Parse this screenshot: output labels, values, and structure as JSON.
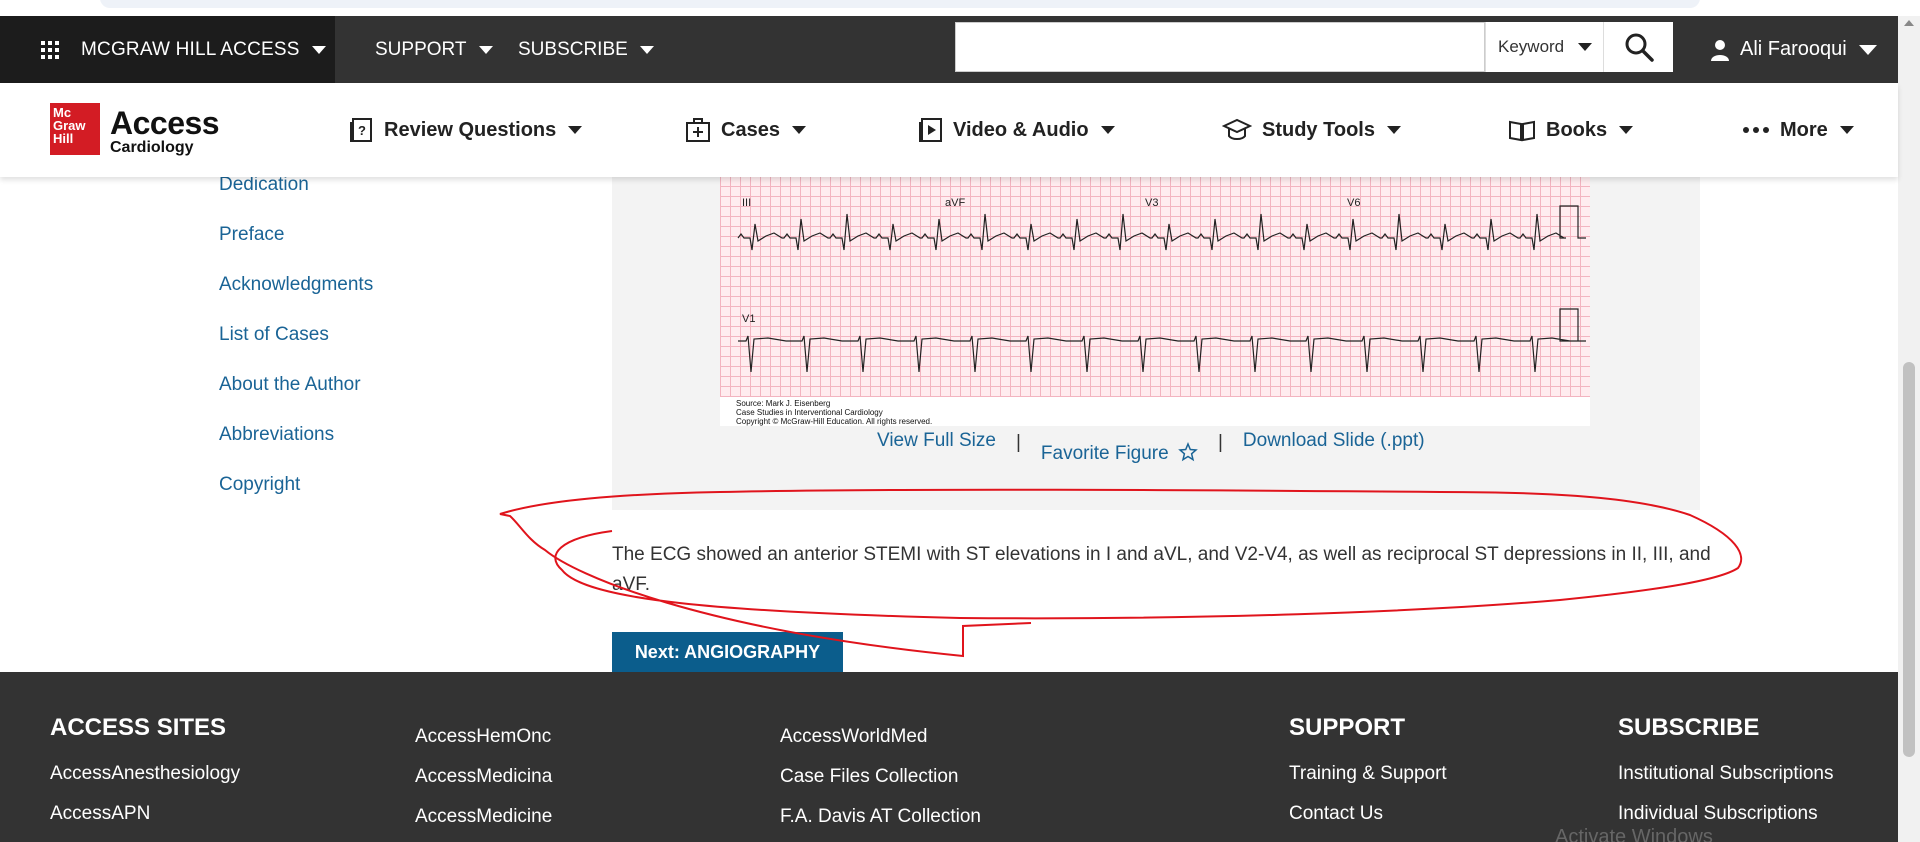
{
  "topbar": {
    "brand": "MCGRAW HILL ACCESS",
    "nav": [
      "SUPPORT",
      "SUBSCRIBE"
    ],
    "search_placeholder": "",
    "search_scope": "Keyword",
    "user_name": "Ali Farooqui"
  },
  "header": {
    "logo_mcgraw": "Mc Graw Hill",
    "logo_access": "Access",
    "logo_sub": "Cardiology",
    "nav": [
      {
        "label": "Review Questions",
        "icon": "question-book-icon"
      },
      {
        "label": "Cases",
        "icon": "briefcase-plus-icon"
      },
      {
        "label": "Video & Audio",
        "icon": "video-book-icon"
      },
      {
        "label": "Study Tools",
        "icon": "graduation-cap-icon"
      },
      {
        "label": "Books",
        "icon": "open-book-icon"
      },
      {
        "label": "More",
        "icon": "dots-icon"
      }
    ]
  },
  "sidebar": {
    "items": [
      "Dedication",
      "Preface",
      "Acknowledgments",
      "List of Cases",
      "About the Author",
      "Abbreviations",
      "Copyright"
    ]
  },
  "figure": {
    "lead_labels": [
      "III",
      "aVF",
      "V3",
      "V6",
      "V1"
    ],
    "source_lines": [
      "Source: Mark J. Eisenberg",
      "Case Studies in Interventional Cardiology",
      "Copyright © McGraw-Hill Education. All rights reserved."
    ],
    "links": {
      "view_full": "View Full Size",
      "favorite": "Favorite Figure",
      "download": "Download Slide (.ppt)",
      "separator": "|"
    }
  },
  "caption": "The ECG showed an anterior STEMI with ST elevations in I and aVL, and V2-V4, as well as reciprocal ST depressions in II, III, and aVF.",
  "next_button": "Next: ANGIOGRAPHY",
  "footer": {
    "access_sites": {
      "heading": "ACCESS SITES",
      "col1": [
        "AccessAnesthesiology",
        "AccessAPN"
      ],
      "col2": [
        "AccessHemOnc",
        "AccessMedicina",
        "AccessMedicine"
      ],
      "col3": [
        "AccessWorldMed",
        "Case Files Collection",
        "F.A. Davis AT Collection"
      ]
    },
    "support": {
      "heading": "SUPPORT",
      "items": [
        "Training & Support",
        "Contact Us"
      ]
    },
    "subscribe": {
      "heading": "SUBSCRIBE",
      "items": [
        "Institutional Subscriptions",
        "Individual Subscriptions"
      ]
    }
  },
  "watermark": "Activate Windows",
  "colors": {
    "topbar": "#333333",
    "brand_bg": "#1c1c1c",
    "link": "#1a6496",
    "button": "#0b5d8c",
    "annotation": "#e0141c",
    "logo_red": "#d31c24"
  }
}
